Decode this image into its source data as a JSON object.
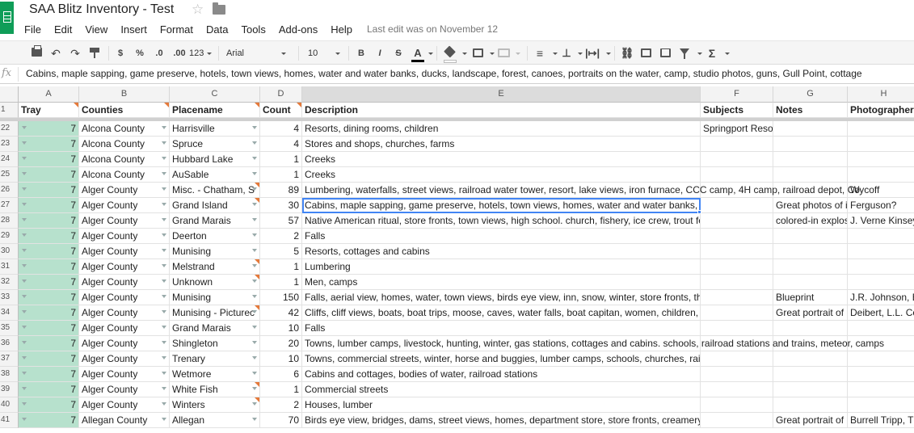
{
  "app": {
    "title": "SAA Blitz Inventory - Test",
    "last_edit": "Last edit was on November 12"
  },
  "menu": [
    "File",
    "Edit",
    "View",
    "Insert",
    "Format",
    "Data",
    "Tools",
    "Add-ons",
    "Help"
  ],
  "toolbar": {
    "currency": "$",
    "percent": "%",
    "dec_decrease": ".0",
    "dec_increase": ".00",
    "more_formats": "123",
    "font": "Arial",
    "font_size": "10",
    "bold": "B",
    "italic": "I",
    "strike": "S",
    "text_color_label": "A",
    "text_color": "#000000",
    "fill_color": "#ffffff",
    "sum": "Σ"
  },
  "formula_bar": {
    "fx": "fx",
    "value": "Cabins, maple sapping, game preserve, hotels, town views, homes, water and water banks, ducks, landscape, forest, canoes, portraits on the water, camp, studio photos, guns, Gull Point, cottage"
  },
  "columns": [
    "A",
    "B",
    "C",
    "D",
    "E",
    "F",
    "G",
    "H"
  ],
  "header_row": {
    "num": "1",
    "cells": [
      "Tray",
      "Counties",
      "Placename",
      "Count",
      "Description",
      "Subjects",
      "Notes",
      "Photographers"
    ]
  },
  "rows": [
    {
      "num": "22",
      "tray": "7",
      "county": "Alcona County",
      "place": "Harrisville",
      "count": "4",
      "desc": "Resorts, dining rooms, children",
      "subjects": "Springport Resort",
      "notes": "",
      "photog": ""
    },
    {
      "num": "23",
      "tray": "7",
      "county": "Alcona County",
      "place": "Spruce",
      "count": "4",
      "desc": "Stores and shops, churches, farms",
      "subjects": "",
      "notes": "",
      "photog": ""
    },
    {
      "num": "24",
      "tray": "7",
      "county": "Alcona County",
      "place": "Hubbard Lake",
      "count": "1",
      "desc": "Creeks",
      "subjects": "",
      "notes": "",
      "photog": ""
    },
    {
      "num": "25",
      "tray": "7",
      "county": "Alcona County",
      "place": "AuSable",
      "count": "1",
      "desc": "Creeks",
      "subjects": "",
      "notes": "",
      "photog": ""
    },
    {
      "num": "26",
      "tray": "7",
      "county": "Alger County",
      "place": "Misc. - Chatham, S",
      "count": "89",
      "desc": "Lumbering, waterfalls, street views, railroad water tower, resort, lake views, iron furnace, CCC camp, 4H camp, railroad depot, Co",
      "subjects": "",
      "notes": "",
      "photog": "Wycoff"
    },
    {
      "num": "27",
      "tray": "7",
      "county": "Alger County",
      "place": "Grand Island",
      "count": "30",
      "desc": "Cabins, maple sapping, game preserve, hotels, town views, homes, water and water banks, ducks, landscape,",
      "subjects": "",
      "notes": "Great photos of i",
      "photog": "Ferguson?"
    },
    {
      "num": "28",
      "tray": "7",
      "county": "Alger County",
      "place": "Grand Marais",
      "count": "57",
      "desc": "Native American ritual, store fronts, town views, high school. church, fishery, ice crew, trout feeding station, pic",
      "subjects": "",
      "notes": "colored-in explos",
      "photog": "J. Verne Kinsey"
    },
    {
      "num": "29",
      "tray": "7",
      "county": "Alger County",
      "place": "Deerton",
      "count": "2",
      "desc": "Falls",
      "subjects": "",
      "notes": "",
      "photog": ""
    },
    {
      "num": "30",
      "tray": "7",
      "county": "Alger County",
      "place": "Munising",
      "count": "5",
      "desc": "Resorts, cottages and cabins",
      "subjects": "",
      "notes": "",
      "photog": ""
    },
    {
      "num": "31",
      "tray": "7",
      "county": "Alger County",
      "place": "Melstrand",
      "count": "1",
      "desc": "Lumbering",
      "subjects": "",
      "notes": "",
      "photog": ""
    },
    {
      "num": "32",
      "tray": "7",
      "county": "Alger County",
      "place": "Unknown",
      "count": "1",
      "desc": "Men, camps",
      "subjects": "",
      "notes": "",
      "photog": ""
    },
    {
      "num": "33",
      "tray": "7",
      "county": "Alger County",
      "place": "Munising",
      "count": "150",
      "desc": "Falls, aerial view, homes, water, town views, birds eye view, inn, snow, winter, store fronts, theatre, bank, lumb",
      "subjects": "",
      "notes": "Blueprint",
      "photog": "J.R. Johnson, E"
    },
    {
      "num": "34",
      "tray": "7",
      "county": "Alger County",
      "place": "Munising - Picturec",
      "count": "42",
      "desc": "Cliffs, cliff views, boats, boat trips, moose, caves, water falls, boat capitan, women, children, grocery",
      "subjects": "",
      "notes": "Great portrait of ",
      "photog": "Deibert, L.L. Co"
    },
    {
      "num": "35",
      "tray": "7",
      "county": "Alger County",
      "place": "Grand Marais",
      "count": "10",
      "desc": "Falls",
      "subjects": "",
      "notes": "",
      "photog": ""
    },
    {
      "num": "36",
      "tray": "7",
      "county": "Alger County",
      "place": "Shingleton",
      "count": "20",
      "desc": "Towns, lumber camps, livestock, hunting, winter, gas stations, cottages and cabins. schools, railroad stations and trains, meteor, camps",
      "subjects": "",
      "notes": "",
      "photog": ""
    },
    {
      "num": "37",
      "tray": "7",
      "county": "Alger County",
      "place": "Trenary",
      "count": "10",
      "desc": "Towns, commercial streets, winter, horse and buggies, lumber camps, schools, churches, railroad stations",
      "subjects": "",
      "notes": "",
      "photog": ""
    },
    {
      "num": "38",
      "tray": "7",
      "county": "Alger County",
      "place": "Wetmore",
      "count": "6",
      "desc": "Cabins and cottages, bodies of water, railroad stations",
      "subjects": "",
      "notes": "",
      "photog": ""
    },
    {
      "num": "39",
      "tray": "7",
      "county": "Alger County",
      "place": "White Fish",
      "count": "1",
      "desc": "Commercial streets",
      "subjects": "",
      "notes": "",
      "photog": ""
    },
    {
      "num": "40",
      "tray": "7",
      "county": "Alger County",
      "place": "Winters",
      "count": "2",
      "desc": "Houses, lumber",
      "subjects": "",
      "notes": "",
      "photog": ""
    },
    {
      "num": "41",
      "tray": "7",
      "county": "Allegan County",
      "place": "Allegan",
      "count": "70",
      "desc": "Birds eye view, bridges, dams, street views, homes, department store, store fronts, creamery, court house, sch",
      "subjects": "",
      "notes": "Great portrait of ",
      "photog": "Burrell Tripp, Th"
    }
  ],
  "colors": {
    "tray_fill": "#b7e1cd",
    "selection": "#4285f4",
    "note_marker": "#e5793a",
    "brand": "#0f9d58"
  }
}
